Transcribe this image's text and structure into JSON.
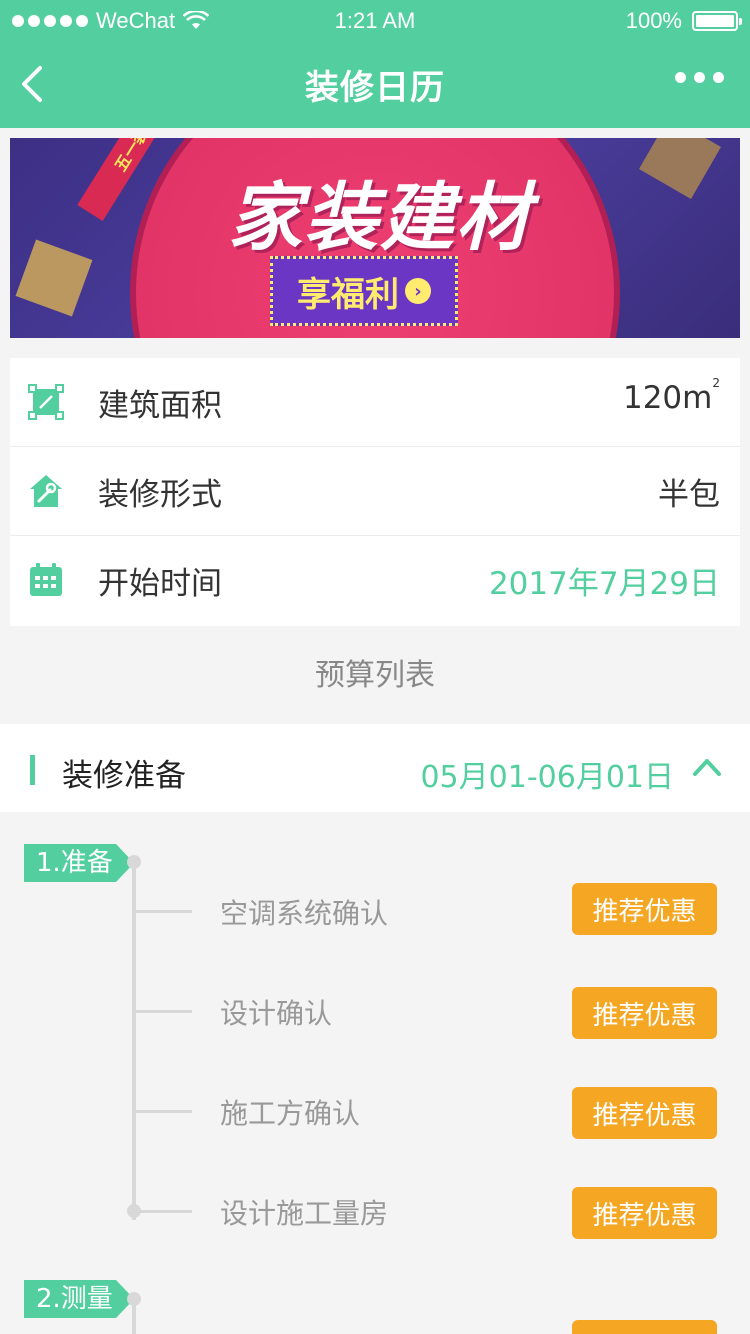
{
  "status_bar": {
    "carrier": "WeChat",
    "time": "1:21 AM",
    "battery": "100%"
  },
  "nav": {
    "title": "装修日历"
  },
  "banner": {
    "headline": "家装建材",
    "ribbon": "五一装修建材",
    "cta": "享福利"
  },
  "info": {
    "area_label": "建筑面积",
    "area_value": "120m",
    "area_unit_sup": "2",
    "style_label": "装修形式",
    "style_value": "半包",
    "start_label": "开始时间",
    "start_value": "2017年7月29日"
  },
  "budget_title": "预算列表",
  "section": {
    "title": "装修准备",
    "range": "05月01-06月01日"
  },
  "steps": [
    {
      "tag": "1.准备"
    },
    {
      "tag": "2.测量"
    }
  ],
  "items": [
    {
      "label": "空调系统确认",
      "button": "推荐优惠"
    },
    {
      "label": "设计确认",
      "button": "推荐优惠"
    },
    {
      "label": "施工方确认",
      "button": "推荐优惠"
    },
    {
      "label": "设计施工量房",
      "button": "推荐优惠"
    }
  ],
  "colors": {
    "accent": "#53cf9f",
    "promo": "#f5a623"
  }
}
